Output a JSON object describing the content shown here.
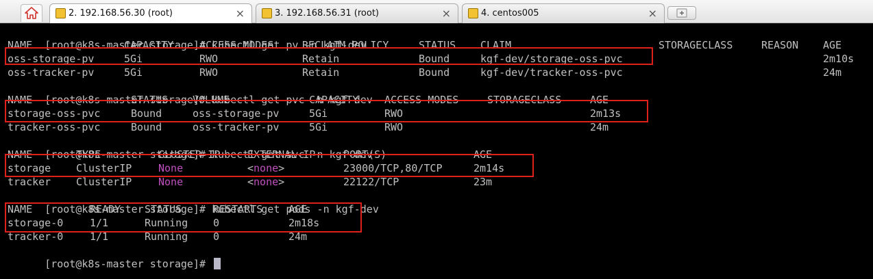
{
  "tabs": [
    {
      "label": "2. 192.168.56.30 (root)",
      "active": true,
      "closable": true
    },
    {
      "label": "3. 192.168.56.31 (root)",
      "active": false,
      "closable": true
    },
    {
      "label": "4. centos005",
      "active": false,
      "closable": true
    }
  ],
  "close_glyph": "×",
  "prompt": "[root@k8s-master storage]# ",
  "commands": {
    "pv": "kubectl get pv -n kgf-dev",
    "pvc": "kubectl get pvc -n kgf-dev",
    "svc": "kubectl get svc -n kgf-dev",
    "pods": "kubectl get pods -n kgf-dev"
  },
  "pv_table": {
    "headers": [
      "NAME",
      "CAPACITY",
      "ACCESS MODES",
      "RECLAIM POLICY",
      "STATUS",
      "CLAIM",
      "STORAGECLASS",
      "REASON",
      "AGE"
    ],
    "rows": [
      [
        "oss-storage-pv",
        "5Gi",
        "RWO",
        "Retain",
        "Bound",
        "kgf-dev/storage-oss-pvc",
        "",
        "",
        "2m10s"
      ],
      [
        "oss-tracker-pv",
        "5Gi",
        "RWO",
        "Retain",
        "Bound",
        "kgf-dev/tracker-oss-pvc",
        "",
        "",
        "24m"
      ]
    ]
  },
  "pvc_table": {
    "headers": [
      "NAME",
      "STATUS",
      "VOLUME",
      "CAPACITY",
      "ACCESS MODES",
      "STORAGECLASS",
      "AGE"
    ],
    "rows": [
      [
        "storage-oss-pvc",
        "Bound",
        "oss-storage-pv",
        "5Gi",
        "RWO",
        "",
        "2m13s"
      ],
      [
        "tracker-oss-pvc",
        "Bound",
        "oss-tracker-pv",
        "5Gi",
        "RWO",
        "",
        "24m"
      ]
    ]
  },
  "svc_table": {
    "headers": [
      "NAME",
      "TYPE",
      "CLUSTER-IP",
      "EXTERNAL-IP",
      "PORT(S)",
      "AGE"
    ],
    "rows": [
      [
        "storage",
        "ClusterIP",
        "None",
        "<none>",
        "23000/TCP,80/TCP",
        "2m14s"
      ],
      [
        "tracker",
        "ClusterIP",
        "None",
        "<none>",
        "22122/TCP",
        "23m"
      ]
    ]
  },
  "pods_table": {
    "headers": [
      "NAME",
      "READY",
      "STATUS",
      "RESTARTS",
      "AGE"
    ],
    "rows": [
      [
        "storage-0",
        "1/1",
        "Running",
        "0",
        "2m18s"
      ],
      [
        "tracker-0",
        "1/1",
        "Running",
        "0",
        "24m"
      ]
    ]
  },
  "colors": {
    "terminal_bg": "#000000",
    "terminal_fg": "#c0c0c0",
    "cluster_ip_none": "#c050c0",
    "highlight_box": "#e0201a"
  },
  "icons": {
    "home": "home-icon",
    "tab": "session-terminal-icon",
    "new_tab": "new-tab-icon"
  }
}
